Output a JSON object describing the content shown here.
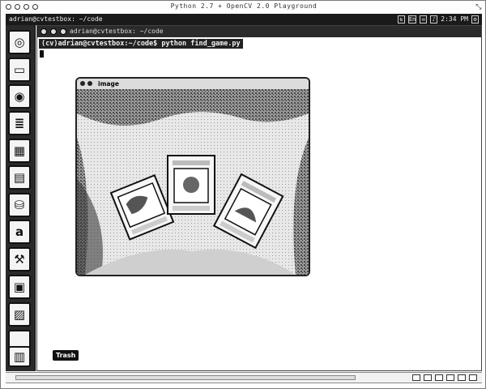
{
  "outer_window": {
    "title": "Python 2.7 + OpenCV 2.0 Playground"
  },
  "top_panel": {
    "terminal_label": "adrian@cvtestbox: ~/code",
    "tray": {
      "keyboard": "En",
      "time": "2:34 PM"
    }
  },
  "launcher": {
    "items": [
      {
        "label": "",
        "icon": "ubuntu-logo-icon"
      },
      {
        "label": "",
        "icon": "home-folder-icon"
      },
      {
        "label": "",
        "icon": "firefox-icon"
      },
      {
        "label": "",
        "icon": "writer-icon"
      },
      {
        "label": "",
        "icon": "calc-icon"
      },
      {
        "label": "",
        "icon": "impress-icon"
      },
      {
        "label": "",
        "icon": "software-center-icon"
      },
      {
        "label": "a",
        "icon": "amazon-icon"
      },
      {
        "label": "",
        "icon": "system-settings-icon"
      },
      {
        "label": "",
        "icon": "workspace-switcher-icon"
      },
      {
        "label": "",
        "icon": "terminal-icon"
      },
      {
        "label": "",
        "icon": "blank-icon"
      },
      {
        "label": "",
        "icon": "trash-icon"
      }
    ]
  },
  "terminal": {
    "title": "adrian@cvtestbox: ~/code",
    "prompt": "(cv)adrian@cvtestbox:~/code$ python find_game.py"
  },
  "image_window": {
    "title": "image"
  },
  "dock": {
    "trash_label": "Trash"
  }
}
